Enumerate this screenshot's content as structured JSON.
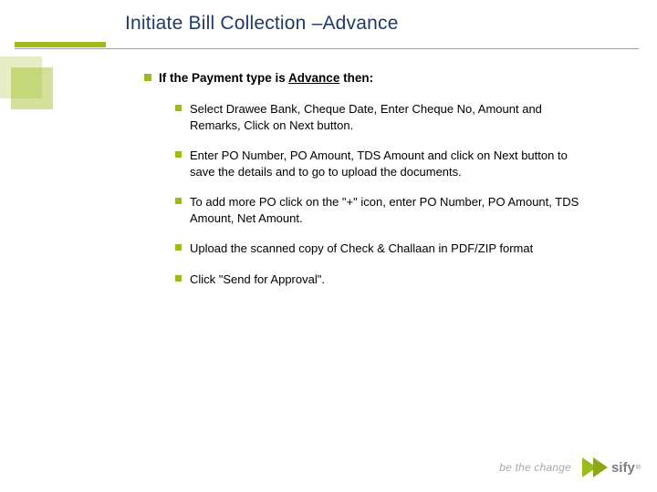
{
  "title": "Initiate Bill Collection –Advance",
  "intro": {
    "prefix": "If the Payment type is ",
    "underlined": "Advance",
    "suffix": " then:"
  },
  "bullets": [
    "Select Drawee Bank, Cheque Date, Enter Cheque No, Amount and Remarks, Click on Next button.",
    "Enter PO Number, PO Amount, TDS Amount and click on Next button to save the details and to go to upload the documents.",
    "To add more PO click on the \"+\" icon, enter PO Number, PO Amount, TDS Amount, Net Amount.",
    "Upload the scanned copy of Check & Challaan in PDF/ZIP format",
    "Click \"Send for Approval\"."
  ],
  "footer": {
    "tagline": "be the change",
    "brand": "sify"
  }
}
